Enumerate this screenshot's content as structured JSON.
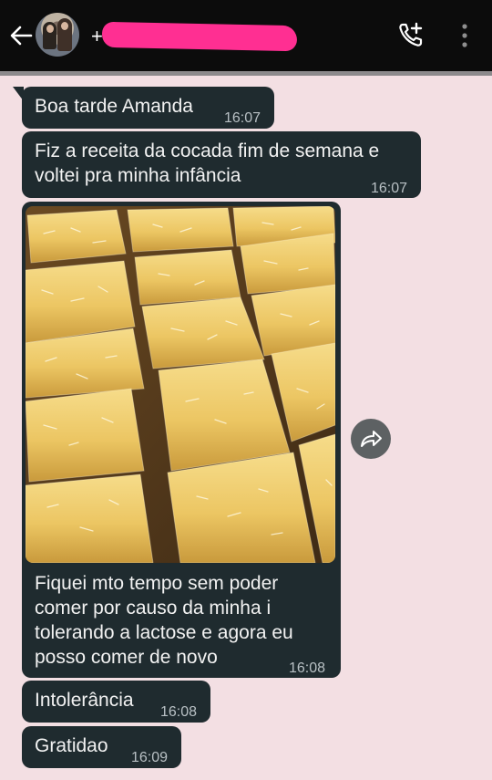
{
  "header": {
    "contact_name": "+5",
    "back_icon": "arrow-left-icon",
    "call_icon": "add-call-icon",
    "menu_icon": "more-vertical-icon"
  },
  "messages": [
    {
      "text": "Boa tarde Amanda",
      "time": "16:07"
    },
    {
      "text": "Fiz a receita da cocada fim de semana e\nvoltei pra minha infância",
      "time": "16:07"
    },
    {
      "caption": "Fiquei mto tempo sem poder\ncomer por causo da minha i\ntolerando a lactose e agora eu\nposso comer de novo",
      "time": "16:08",
      "image": "coconut-bars-photo"
    },
    {
      "text": "Intolerância",
      "time": "16:08"
    },
    {
      "text": "Gratidao",
      "time": "16:09"
    }
  ],
  "colors": {
    "background": "#f3dfe3",
    "bubble": "#1f2b2f",
    "header": "#0c0c0c",
    "redaction": "#ff2f92"
  }
}
